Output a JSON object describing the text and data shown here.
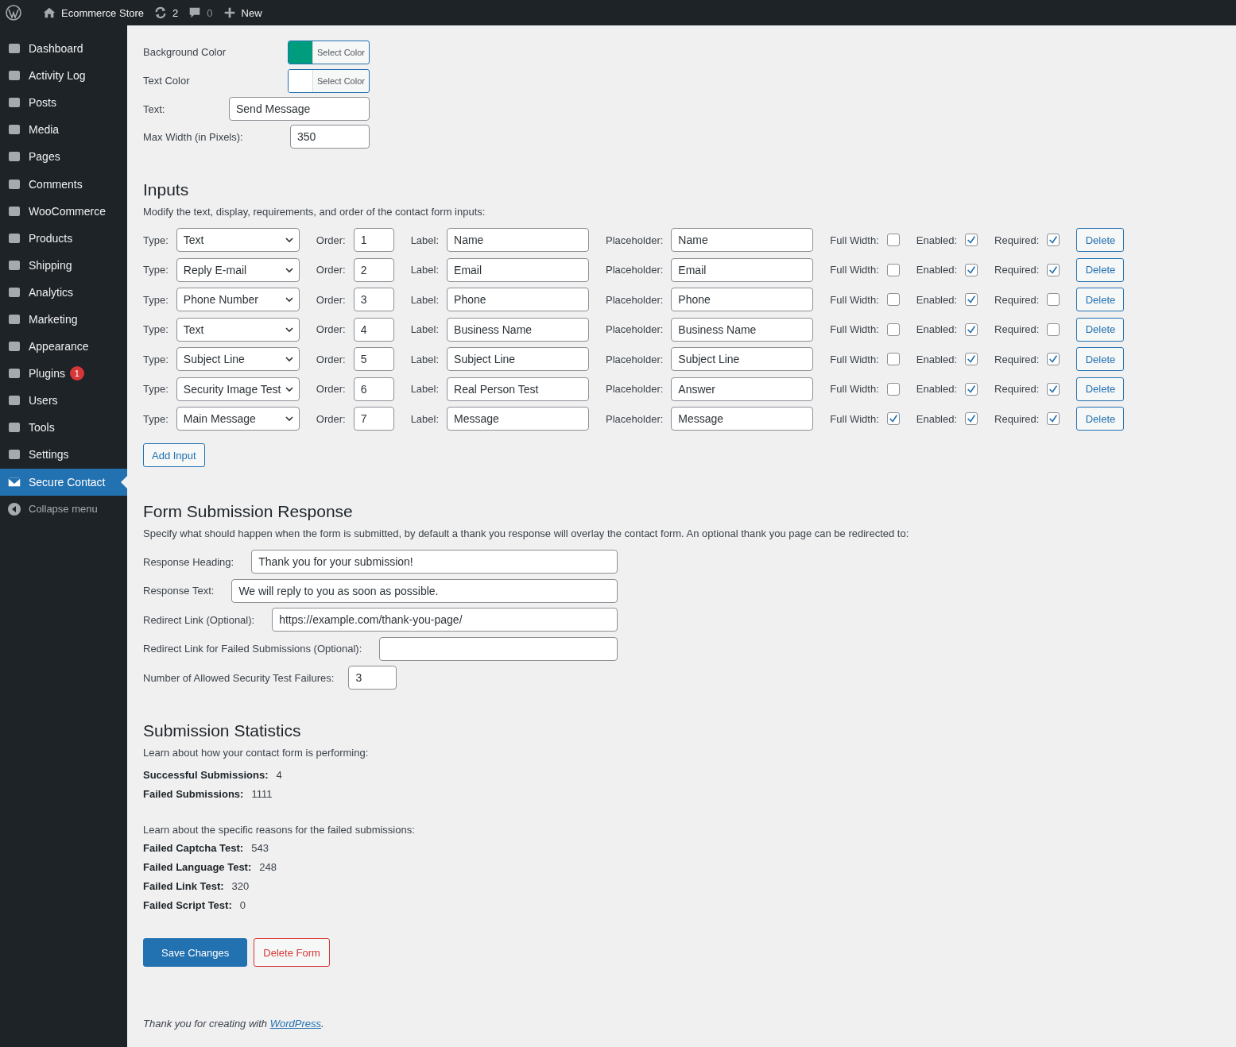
{
  "admin_bar": {
    "site_name": "Ecommerce Store",
    "updates": "2",
    "comments": "0",
    "new_label": "New"
  },
  "sidebar": {
    "items": [
      {
        "label": "Dashboard",
        "selected": false
      },
      {
        "label": "Activity Log",
        "selected": false
      },
      {
        "label": "Posts",
        "selected": false
      },
      {
        "label": "Media",
        "selected": false
      },
      {
        "label": "Pages",
        "selected": false
      },
      {
        "label": "Comments",
        "selected": false
      },
      {
        "label": "WooCommerce",
        "selected": false
      },
      {
        "label": "Products",
        "selected": false
      },
      {
        "label": "Shipping",
        "selected": false
      },
      {
        "label": "Analytics",
        "selected": false
      },
      {
        "label": "Marketing",
        "selected": false
      },
      {
        "label": "Appearance",
        "selected": false
      },
      {
        "label": "Plugins",
        "selected": false,
        "badge": "1"
      },
      {
        "label": "Users",
        "selected": false
      },
      {
        "label": "Tools",
        "selected": false
      },
      {
        "label": "Settings",
        "selected": false
      },
      {
        "label": "Secure Contact",
        "selected": true
      }
    ],
    "collapse": "Collapse menu"
  },
  "button_style": {
    "colors": [
      {
        "label": "Background Color",
        "button": "Select Color",
        "color": "#009c7e"
      },
      {
        "label": "Text Color",
        "button": "Select Color",
        "color": "#ffffff"
      }
    ],
    "text_label": "Text:",
    "text_value": "Send Message",
    "width_label": "Max Width (in Pixels):",
    "width_value": "350"
  },
  "inputs": {
    "title": "Inputs",
    "description": "Modify the text, display, requirements, and order of the contact form inputs:",
    "rows": [
      {
        "type_label": "Type:",
        "type": "Text",
        "order_label": "Order:",
        "order": "1",
        "label_label": "Label:",
        "label": "Name",
        "placeholder_label": "Placeholder:",
        "default_text": "Name",
        "full_width_label": "Full Width:",
        "full_width": false,
        "enabled_label": "Enabled:",
        "enabled": true,
        "required_label": "Required:",
        "required": true,
        "delete": "Delete"
      },
      {
        "type_label": "Type:",
        "type": "Reply E-mail",
        "order_label": "Order:",
        "order": "2",
        "label_label": "Label:",
        "label": "Email",
        "placeholder_label": "Placeholder:",
        "default_text": "Email",
        "full_width_label": "Full Width:",
        "full_width": false,
        "enabled_label": "Enabled:",
        "enabled": true,
        "required_label": "Required:",
        "required": true,
        "delete": "Delete"
      },
      {
        "type_label": "Type:",
        "type": "Phone Number",
        "order_label": "Order:",
        "order": "3",
        "label_label": "Label:",
        "label": "Phone",
        "placeholder_label": "Placeholder:",
        "default_text": "Phone",
        "full_width_label": "Full Width:",
        "full_width": false,
        "enabled_label": "Enabled:",
        "enabled": true,
        "required_label": "Required:",
        "required": false,
        "delete": "Delete"
      },
      {
        "type_label": "Type:",
        "type": "Text",
        "order_label": "Order:",
        "order": "4",
        "label_label": "Label:",
        "label": "Business Name",
        "placeholder_label": "Placeholder:",
        "default_text": "Business Name",
        "full_width_label": "Full Width:",
        "full_width": false,
        "enabled_label": "Enabled:",
        "enabled": true,
        "required_label": "Required:",
        "required": false,
        "delete": "Delete"
      },
      {
        "type_label": "Type:",
        "type": "Subject Line",
        "order_label": "Order:",
        "order": "5",
        "label_label": "Label:",
        "label": "Subject Line",
        "placeholder_label": "Placeholder:",
        "default_text": "Subject Line",
        "full_width_label": "Full Width:",
        "full_width": false,
        "enabled_label": "Enabled:",
        "enabled": true,
        "required_label": "Required:",
        "required": true,
        "delete": "Delete"
      },
      {
        "type_label": "Type:",
        "type": "Security Image Test",
        "order_label": "Order:",
        "order": "6",
        "label_label": "Label:",
        "label": "Real Person Test",
        "placeholder_label": "Placeholder:",
        "default_text": "Answer",
        "full_width_label": "Full Width:",
        "full_width": false,
        "enabled_label": "Enabled:",
        "enabled": true,
        "required_label": "Required:",
        "required": true,
        "delete": "Delete"
      },
      {
        "type_label": "Type:",
        "type": "Main Message",
        "order_label": "Order:",
        "order": "7",
        "label_label": "Label:",
        "label": "Message",
        "placeholder_label": "Placeholder:",
        "default_text": "Message",
        "full_width_label": "Full Width:",
        "full_width": true,
        "enabled_label": "Enabled:",
        "enabled": true,
        "required_label": "Required:",
        "required": true,
        "delete": "Delete"
      }
    ],
    "add_button": "Add Input"
  },
  "response": {
    "title": "Form Submission Response",
    "description": "Specify what should happen when the form is submitted, by default a thank you response will overlay the contact form. An optional thank you page can be redirected to:",
    "fields": [
      {
        "label": "Response Heading:",
        "value": "Thank you for your submission!",
        "kind": "wide"
      },
      {
        "label": "Response Text:",
        "value": "We will reply to you as soon as possible.",
        "kind": "wide"
      },
      {
        "label": "Redirect Link (Optional):",
        "value": "https://example.com/thank-you-page/",
        "kind": "wide"
      },
      {
        "label": "Redirect Link for Failed Submissions (Optional):",
        "kind": "wide"
      },
      {
        "label": "Number of Allowed Security Test Failures:",
        "value": "3",
        "kind": "short"
      }
    ]
  },
  "statistics": {
    "title": "Submission Statistics",
    "description": "Learn about how your contact form is performing:",
    "totals": [
      {
        "label": "Successful Submissions:",
        "value": "4"
      },
      {
        "label": "Failed Submissions:",
        "value": "1111"
      }
    ],
    "reasons_intro": "Learn about the specific reasons for the failed submissions:",
    "reasons": [
      {
        "label": "Failed Captcha Test:",
        "value": "543"
      },
      {
        "label": "Failed Language Test:",
        "value": "248"
      },
      {
        "label": "Failed Link Test:",
        "value": "320"
      },
      {
        "label": "Failed Script Test:",
        "value": "0"
      }
    ]
  },
  "actions": {
    "save": "Save Changes",
    "delete": "Delete Form"
  },
  "footer": {
    "text": "Thank you for creating with ",
    "link": "WordPress",
    "after": "."
  }
}
